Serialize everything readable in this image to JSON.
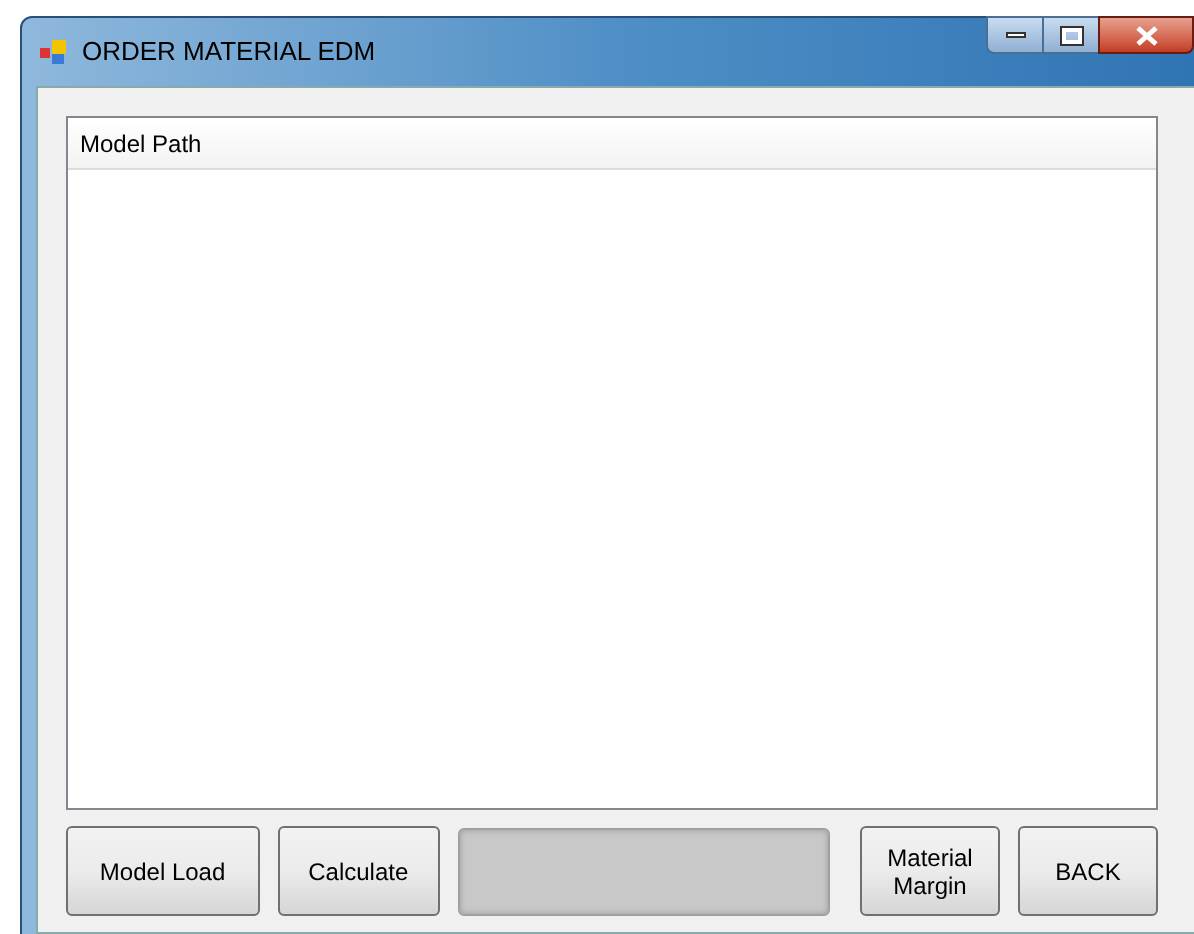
{
  "window": {
    "title": "ORDER MATERIAL EDM"
  },
  "list": {
    "columns": [
      "Model Path"
    ]
  },
  "buttons": [
    {
      "label": "Model Load"
    },
    {
      "label": "Calculate"
    }
  ],
  "progress": {
    "level": 0
  },
  "buttons_right": [
    {
      "label": "Material\nMargin"
    },
    {
      "label": "BACK"
    }
  ]
}
